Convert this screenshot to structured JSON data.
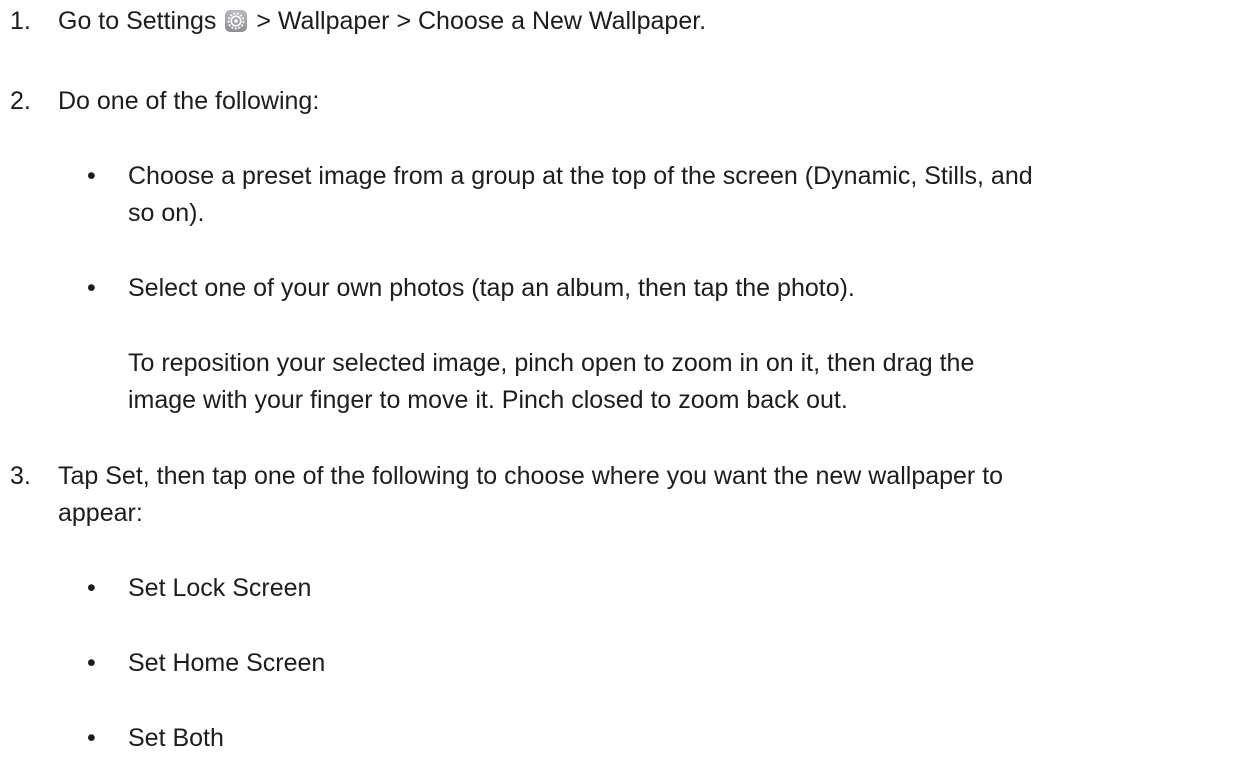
{
  "steps": [
    {
      "number": "1.",
      "text_before_icon": "Go to Settings",
      "icon": "settings-gear-icon",
      "text_after_icon": "> Wallpaper > Choose a New Wallpaper."
    },
    {
      "number": "2.",
      "text": "Do one of the following:",
      "bullets": [
        {
          "line1": "Choose a preset image from a group at the top of the screen (Dynamic, Stills, and",
          "line2": "so on)."
        },
        {
          "line1": "Select one of your own photos (tap an album, then tap the photo)."
        }
      ],
      "note": {
        "line1": "To reposition your selected image, pinch open to zoom in on it, then drag the",
        "line2": "image with your finger to move it. Pinch closed to zoom back out."
      }
    },
    {
      "number": "3.",
      "line1": "Tap Set, then tap one of the following to choose where you want the new wallpaper to",
      "line2": "appear:",
      "bullets": [
        "Set Lock Screen",
        "Set Home Screen",
        "Set Both"
      ]
    }
  ],
  "bullet_glyph": "•"
}
